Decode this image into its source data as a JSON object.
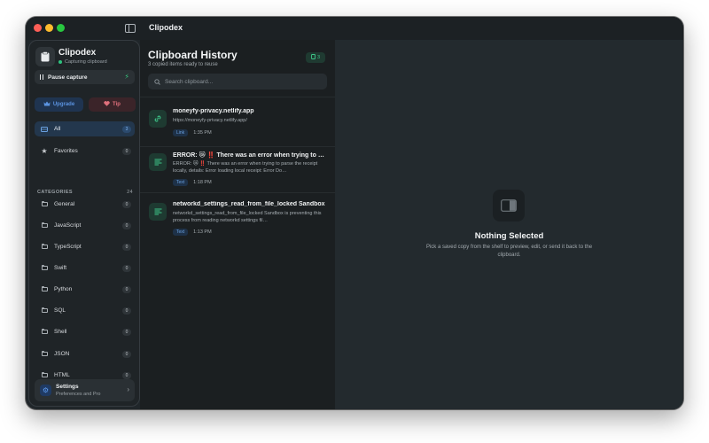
{
  "window": {
    "title": "Clipodex"
  },
  "sidebar": {
    "brand_name": "Clipodex",
    "brand_status": "Capturing clipboard",
    "pause_label": "Pause capture",
    "upgrade_label": "Upgrade",
    "tip_label": "Tip",
    "nav": [
      {
        "label": "All",
        "count": "3",
        "icon": "archive-icon",
        "active": true
      },
      {
        "label": "Favorites",
        "count": "0",
        "icon": "star-icon",
        "active": false
      }
    ],
    "categories_header": "CATEGORIES",
    "categories_total": "24",
    "categories": [
      {
        "label": "General",
        "count": "0"
      },
      {
        "label": "JavaScript",
        "count": "0"
      },
      {
        "label": "TypeScript",
        "count": "0"
      },
      {
        "label": "Swift",
        "count": "0"
      },
      {
        "label": "Python",
        "count": "0"
      },
      {
        "label": "SQL",
        "count": "0"
      },
      {
        "label": "Shell",
        "count": "0"
      },
      {
        "label": "JSON",
        "count": "0"
      },
      {
        "label": "HTML",
        "count": "0"
      }
    ],
    "settings_title": "Settings",
    "settings_sub": "Preferences and Pro"
  },
  "history": {
    "title": "Clipboard History",
    "subtitle": "3 copied items ready to reuse",
    "count": "3",
    "search_placeholder": "Search clipboard...",
    "items": [
      {
        "title": "moneyfy-privacy.netlify.app",
        "preview": "https://moneyfy-privacy.netlify.app/",
        "tag": "Link",
        "time": "1:35 PM",
        "icon": "link-icon"
      },
      {
        "title": "ERROR: 😿 ‼️ There was an error when trying to parse the receipt locally",
        "preview": "ERROR: 😿 ‼️ There was an error when trying to parse the receipt locally, details: Error loading local receipt: Error Do…",
        "tag": "Text",
        "time": "1:18 PM",
        "icon": "text-lines-icon"
      },
      {
        "title": "networkd_settings_read_from_file_locked Sandbox",
        "preview": "networkd_settings_read_from_file_locked Sandbox is preventing this process from reading networkd settings fil…",
        "tag": "Text",
        "time": "1:13 PM",
        "icon": "text-lines-icon"
      }
    ]
  },
  "preview": {
    "empty_title": "Nothing Selected",
    "empty_desc": "Pick a saved copy from the shelf to preview, edit, or send it back to the clipboard."
  },
  "colors": {
    "accent_blue": "#5b93e0",
    "accent_green": "#3ec689",
    "tip_red": "#e0707c"
  }
}
